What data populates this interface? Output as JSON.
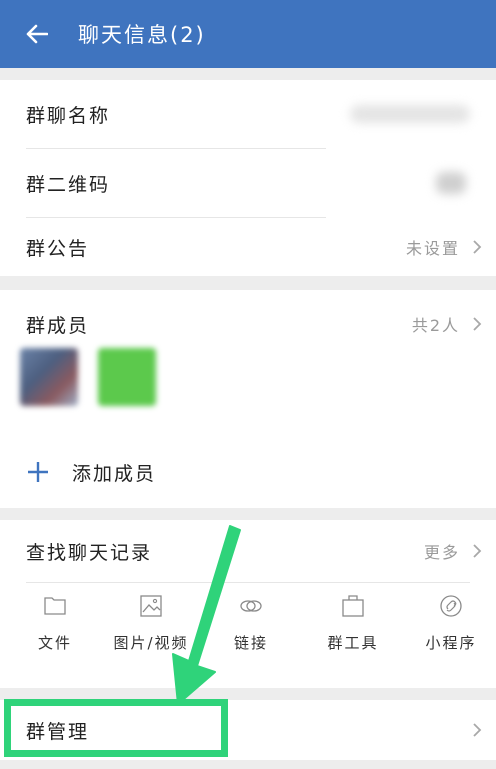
{
  "header": {
    "title": "聊天信息(2)"
  },
  "group_info": {
    "name_label": "群聊名称",
    "qr_label": "群二维码",
    "notice_label": "群公告",
    "notice_value": "未设置"
  },
  "members": {
    "label": "群成员",
    "count_text": "共2人",
    "add_label": "添加成员"
  },
  "history": {
    "search_label": "查找聊天记录",
    "more_label": "更多",
    "tools": [
      {
        "label": "文件",
        "icon": "folder-icon"
      },
      {
        "label": "图片/视频",
        "icon": "image-icon"
      },
      {
        "label": "链接",
        "icon": "link-icon"
      },
      {
        "label": "群工具",
        "icon": "briefcase-icon"
      },
      {
        "label": "小程序",
        "icon": "mini-program-icon"
      }
    ]
  },
  "manage": {
    "label": "群管理"
  },
  "colors": {
    "header": "#3f74bf",
    "highlight": "#2fd37a",
    "accent": "#3f74bf"
  }
}
